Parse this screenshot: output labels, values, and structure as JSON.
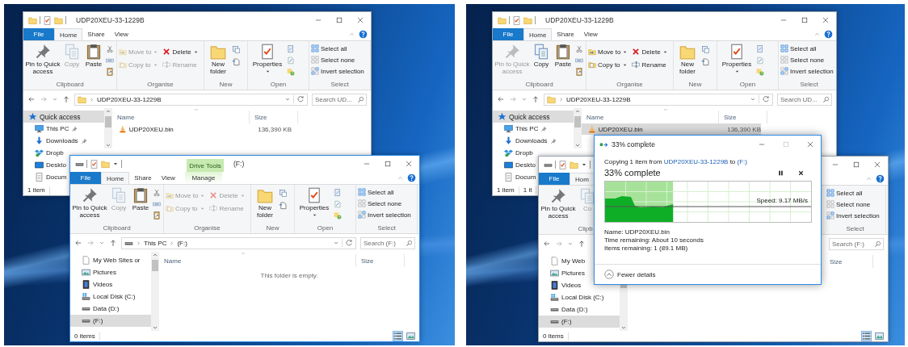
{
  "panels": [
    {
      "windows": [
        {
          "kind": "folder",
          "active": false,
          "title": "UDP20XEU-33-1229B",
          "tabs": [
            {
              "label": "File",
              "kind": "file",
              "selected": false
            },
            {
              "label": "Home",
              "kind": "tab",
              "selected": true
            },
            {
              "label": "Share",
              "kind": "tab",
              "selected": false
            },
            {
              "label": "View",
              "kind": "tab",
              "selected": false
            }
          ],
          "ribbon": [
            {
              "kind": "clipboard",
              "label": "Clipboard",
              "items": [
                {
                  "kind": "pin",
                  "label": "Pin to Quick access",
                  "disabled": false
                },
                {
                  "kind": "copy",
                  "label": "Copy",
                  "disabled": true
                },
                {
                  "kind": "paste",
                  "label": "Paste",
                  "disabled": false
                }
              ]
            },
            {
              "kind": "organise",
              "label": "Organise",
              "items": [
                {
                  "kind": "move",
                  "label": "Move to",
                  "disabled": true,
                  "dropdown": true
                },
                {
                  "kind": "delete",
                  "label": "Delete",
                  "disabled": false,
                  "dropdown": true
                },
                {
                  "kind": "copyto",
                  "label": "Copy to",
                  "disabled": true,
                  "dropdown": true
                },
                {
                  "kind": "rename",
                  "label": "Rename",
                  "disabled": true,
                  "dropdown": false
                }
              ]
            },
            {
              "kind": "new",
              "label": "New",
              "items": [
                {
                  "kind": "newfolder",
                  "label": "New folder",
                  "disabled": false
                }
              ]
            },
            {
              "kind": "open",
              "label": "Open",
              "items": [
                {
                  "kind": "properties",
                  "label": "Properties",
                  "disabled": false,
                  "dropdown": true
                }
              ]
            },
            {
              "kind": "select",
              "label": "Select",
              "items": [
                {
                  "kind": "selectall",
                  "label": "Select all",
                  "disabled": false
                },
                {
                  "kind": "selectnone",
                  "label": "Select none",
                  "disabled": false
                },
                {
                  "kind": "invert",
                  "label": "Invert selection",
                  "disabled": false
                }
              ]
            }
          ],
          "address": {
            "path": [
              "UDP20XEU-33-1229B"
            ]
          },
          "search": {
            "placeholder": "Search UD..."
          },
          "sidebar": [
            {
              "kind": "quick",
              "label": "Quick access",
              "selected": true,
              "pinned": false
            },
            {
              "kind": "pc",
              "label": "This PC",
              "selected": false,
              "pinned": true
            },
            {
              "kind": "downloads",
              "label": "Downloads",
              "selected": false,
              "pinned": true
            },
            {
              "kind": "dropbox",
              "label": "Dropb",
              "selected": false,
              "pinned": false
            },
            {
              "kind": "desktop",
              "label": "Deskto",
              "selected": false,
              "pinned": false
            },
            {
              "kind": "documents",
              "label": "Docum",
              "selected": false,
              "pinned": false
            }
          ],
          "columns": [
            {
              "kind": "name",
              "label": "Name"
            },
            {
              "kind": "size",
              "label": "Size"
            }
          ],
          "rows": [
            {
              "name": "UDP20XEU.bin",
              "size": "136,390 KB",
              "selected": false
            }
          ],
          "status": [
            "1 item"
          ]
        },
        {
          "kind": "drive",
          "active": true,
          "title": "(F:)",
          "context_tab": {
            "group": "Drive Tools"
          },
          "tabs": [
            {
              "label": "File",
              "kind": "file",
              "selected": false
            },
            {
              "label": "Home",
              "kind": "tab",
              "selected": true
            },
            {
              "label": "Share",
              "kind": "tab",
              "selected": false
            },
            {
              "label": "View",
              "kind": "tab",
              "selected": false
            },
            {
              "label": "Manage",
              "kind": "context",
              "selected": false
            }
          ],
          "ribbon": [
            {
              "kind": "clipboard",
              "label": "Clipboard",
              "items": [
                {
                  "kind": "pin",
                  "label": "Pin to Quick access",
                  "disabled": false
                },
                {
                  "kind": "copy",
                  "label": "Copy",
                  "disabled": true
                },
                {
                  "kind": "paste",
                  "label": "Paste",
                  "disabled": false
                }
              ]
            },
            {
              "kind": "organise",
              "label": "Organise",
              "items": [
                {
                  "kind": "move",
                  "label": "Move to",
                  "disabled": true,
                  "dropdown": true
                },
                {
                  "kind": "delete",
                  "label": "Delete",
                  "disabled": true,
                  "dropdown": true
                },
                {
                  "kind": "copyto",
                  "label": "Copy to",
                  "disabled": true,
                  "dropdown": true
                },
                {
                  "kind": "rename",
                  "label": "Rename",
                  "disabled": true,
                  "dropdown": false
                }
              ]
            },
            {
              "kind": "new",
              "label": "New",
              "items": [
                {
                  "kind": "newfolder",
                  "label": "New folder",
                  "disabled": false
                }
              ]
            },
            {
              "kind": "open",
              "label": "Open",
              "items": [
                {
                  "kind": "properties",
                  "label": "Properties",
                  "disabled": false,
                  "dropdown": true
                }
              ]
            },
            {
              "kind": "select",
              "label": "Select",
              "items": [
                {
                  "kind": "selectall",
                  "label": "Select all",
                  "disabled": false
                },
                {
                  "kind": "selectnone",
                  "label": "Select none",
                  "disabled": false
                },
                {
                  "kind": "invert",
                  "label": "Invert selection",
                  "disabled": false
                }
              ]
            }
          ],
          "address": {
            "path": [
              "This PC",
              "(F:)"
            ]
          },
          "search": {
            "placeholder": "Search (F:)"
          },
          "sidebar": [
            {
              "kind": "page",
              "label": "My Web Sites or",
              "selected": false,
              "pinned": false
            },
            {
              "kind": "pictures",
              "label": "Pictures",
              "selected": false,
              "pinned": false
            },
            {
              "kind": "videos",
              "label": "Videos",
              "selected": false,
              "pinned": false
            },
            {
              "kind": "disk",
              "label": "Local Disk (C:)",
              "selected": false,
              "pinned": false
            },
            {
              "kind": "drive",
              "label": "Data (D:)",
              "selected": false,
              "pinned": false
            },
            {
              "kind": "drive",
              "label": "(F:)",
              "selected": true,
              "pinned": false
            }
          ],
          "columns": [
            {
              "kind": "name",
              "label": "Name"
            },
            {
              "kind": "size",
              "label": "Size"
            }
          ],
          "empty_text": "This folder is empty.",
          "status": [
            "0 items"
          ],
          "view_buttons": [
            {
              "selected": true
            },
            {
              "selected": false
            }
          ]
        }
      ]
    },
    {
      "windows": [
        {
          "kind": "folder",
          "active": false,
          "title": "UDP20XEU-33-1229B",
          "tabs": [
            {
              "label": "File",
              "kind": "file",
              "selected": false
            },
            {
              "label": "Home",
              "kind": "tab",
              "selected": true
            },
            {
              "label": "Share",
              "kind": "tab",
              "selected": false
            },
            {
              "label": "View",
              "kind": "tab",
              "selected": false
            }
          ],
          "ribbon": [
            {
              "kind": "clipboard",
              "label": "Clipboard",
              "items": [
                {
                  "kind": "pin",
                  "label": "Pin to Quick access",
                  "disabled": true
                },
                {
                  "kind": "copy",
                  "label": "Copy",
                  "disabled": false
                },
                {
                  "kind": "paste",
                  "label": "Paste",
                  "disabled": false
                }
              ]
            },
            {
              "kind": "organise",
              "label": "Organise",
              "items": [
                {
                  "kind": "move",
                  "label": "Move to",
                  "disabled": false,
                  "dropdown": true
                },
                {
                  "kind": "delete",
                  "label": "Delete",
                  "disabled": false,
                  "dropdown": true
                },
                {
                  "kind": "copyto",
                  "label": "Copy to",
                  "disabled": false,
                  "dropdown": true
                },
                {
                  "kind": "rename",
                  "label": "Rename",
                  "disabled": false,
                  "dropdown": false
                }
              ]
            },
            {
              "kind": "new",
              "label": "New",
              "items": [
                {
                  "kind": "newfolder",
                  "label": "New folder",
                  "disabled": false
                }
              ]
            },
            {
              "kind": "open",
              "label": "Open",
              "items": [
                {
                  "kind": "properties",
                  "label": "Properties",
                  "disabled": false,
                  "dropdown": true
                }
              ]
            },
            {
              "kind": "select",
              "label": "Select",
              "items": [
                {
                  "kind": "selectall",
                  "label": "Select all",
                  "disabled": false
                },
                {
                  "kind": "selectnone",
                  "label": "Select none",
                  "disabled": false
                },
                {
                  "kind": "invert",
                  "label": "Invert selection",
                  "disabled": false
                }
              ]
            }
          ],
          "address": {
            "path": [
              "UDP20XEU-33-1229B"
            ]
          },
          "search": {
            "placeholder": "Search UD..."
          },
          "sidebar": [
            {
              "kind": "quick",
              "label": "Quick access",
              "selected": true,
              "pinned": false
            },
            {
              "kind": "pc",
              "label": "This PC",
              "selected": false,
              "pinned": true
            },
            {
              "kind": "downloads",
              "label": "Downloads",
              "selected": false,
              "pinned": true
            },
            {
              "kind": "dropbox",
              "label": "Dropb",
              "selected": false,
              "pinned": false
            },
            {
              "kind": "desktop",
              "label": "Deskto",
              "selected": false,
              "pinned": false
            },
            {
              "kind": "documents",
              "label": "Docum",
              "selected": false,
              "pinned": false
            }
          ],
          "columns": [
            {
              "kind": "name",
              "label": "Name"
            },
            {
              "kind": "size",
              "label": "Size"
            }
          ],
          "rows": [
            {
              "name": "UDP20XEU.bin",
              "size": "136,390 KB",
              "selected": true
            }
          ],
          "status": [
            "1 item",
            "1 it"
          ]
        },
        {
          "kind": "drive",
          "active": false,
          "tabs": [
            {
              "label": "File",
              "kind": "file",
              "selected": false
            },
            {
              "label": "Hom",
              "kind": "tab",
              "selected": true
            }
          ],
          "ribbon": [
            {
              "kind": "clipboard",
              "label": "Clipb",
              "items": [
                {
                  "kind": "pin",
                  "label": "Pin to Quick access",
                  "disabled": false
                },
                {
                  "kind": "copy",
                  "label": "Co",
                  "disabled": true
                }
              ]
            },
            {
              "kind": "select",
              "label": "Select",
              "items": [
                {
                  "kind": "selectall",
                  "label": "Select all",
                  "disabled": false
                },
                {
                  "kind": "selectnone",
                  "label": "Select none",
                  "disabled": false
                },
                {
                  "kind": "invert",
                  "label": "Invert selection",
                  "disabled": false
                }
              ]
            }
          ],
          "search": {
            "placeholder": "Search (F:)"
          },
          "sidebar": [
            {
              "kind": "page",
              "label": "My Web",
              "selected": false,
              "pinned": false
            },
            {
              "kind": "pictures",
              "label": "Pictures",
              "selected": false,
              "pinned": false
            },
            {
              "kind": "videos",
              "label": "Videos",
              "selected": false,
              "pinned": false
            },
            {
              "kind": "disk",
              "label": "Local Disk (C:)",
              "selected": false,
              "pinned": false
            },
            {
              "kind": "drive",
              "label": "Data (D:)",
              "selected": false,
              "pinned": false
            },
            {
              "kind": "drive",
              "label": "(F:)",
              "selected": true,
              "pinned": false
            }
          ],
          "columns": [
            {
              "kind": "size",
              "label": "Size"
            }
          ],
          "status": [
            "0 items"
          ],
          "view_buttons": [
            {
              "selected": true
            },
            {
              "selected": false
            }
          ]
        }
      ],
      "dialog": {
        "active": true,
        "title": "33% complete",
        "description": {
          "prefix": "Copying 1 item from",
          "source": "UDP20XEU-33-1229B",
          "middle": "to",
          "destination": "(F:)"
        },
        "heading": "33% complete",
        "level": 0.33,
        "speed": "Speed: 9.17 MB/s",
        "details": [
          "Name: UDP20XEU.bin",
          "Time remaining: About 10 seconds",
          "Items remaining: 1 (89.1 MB)"
        ],
        "toggle": "Fewer details"
      }
    }
  ]
}
